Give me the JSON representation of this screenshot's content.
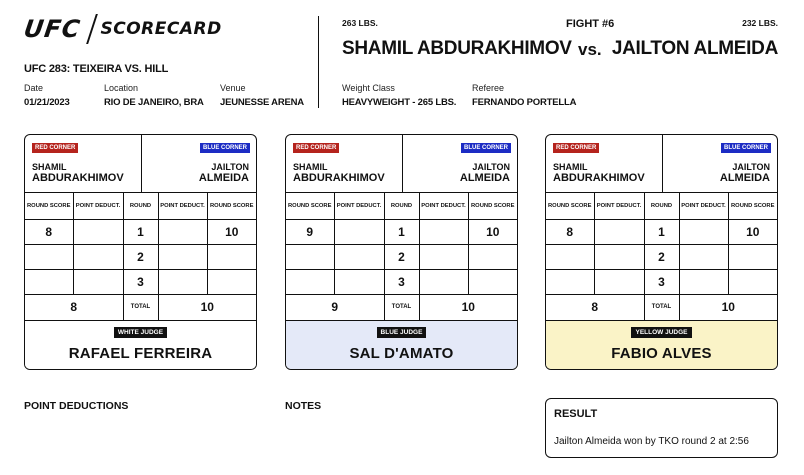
{
  "header": {
    "logo_brand": "UFC",
    "logo_product": "SCORECARD",
    "event_title": "UFC 283: TEIXEIRA VS. HILL",
    "date_label": "Date",
    "date_value": "01/21/2023",
    "location_label": "Location",
    "location_value": "RIO DE JANEIRO, BRA",
    "venue_label": "Venue",
    "venue_value": "JEUNESSE ARENA"
  },
  "fight": {
    "number": "FIGHT #6",
    "vs": "vs.",
    "red_weight": "263 LBS.",
    "red_name": "SHAMIL ABDURAKHIMOV",
    "blue_weight": "232 LBS.",
    "blue_name": "JAILTON ALMEIDA",
    "weight_class_label": "Weight Class",
    "weight_class_value": "HEAVYWEIGHT - 265 LBS.",
    "referee_label": "Referee",
    "referee_value": "FERNANDO PORTELLA"
  },
  "labels": {
    "red_corner": "RED CORNER",
    "blue_corner": "BLUE CORNER",
    "red_first": "SHAMIL",
    "red_last": "ABDURAKHIMOV",
    "blue_first": "JAILTON",
    "blue_last": "ALMEIDA",
    "round_score": "ROUND SCORE",
    "point_deduct": "POINT DEDUCT.",
    "round": "ROUND",
    "total": "TOTAL"
  },
  "cards": [
    {
      "judge_label": "WHITE JUDGE",
      "judge_name": "RAFAEL FERREIRA",
      "judge_color": "#ffffff",
      "rounds": [
        {
          "round": "1",
          "red_score": "8",
          "red_deduct": "",
          "blue_deduct": "",
          "blue_score": "10"
        },
        {
          "round": "2",
          "red_score": "",
          "red_deduct": "",
          "blue_deduct": "",
          "blue_score": ""
        },
        {
          "round": "3",
          "red_score": "",
          "red_deduct": "",
          "blue_deduct": "",
          "blue_score": ""
        }
      ],
      "red_total": "8",
      "blue_total": "10"
    },
    {
      "judge_label": "BLUE JUDGE",
      "judge_name": "SAL D'AMATO",
      "judge_color": "#e4e9f8",
      "rounds": [
        {
          "round": "1",
          "red_score": "9",
          "red_deduct": "",
          "blue_deduct": "",
          "blue_score": "10"
        },
        {
          "round": "2",
          "red_score": "",
          "red_deduct": "",
          "blue_deduct": "",
          "blue_score": ""
        },
        {
          "round": "3",
          "red_score": "",
          "red_deduct": "",
          "blue_deduct": "",
          "blue_score": ""
        }
      ],
      "red_total": "9",
      "blue_total": "10"
    },
    {
      "judge_label": "YELLOW JUDGE",
      "judge_name": "FABIO ALVES",
      "judge_color": "#faf3c7",
      "rounds": [
        {
          "round": "1",
          "red_score": "8",
          "red_deduct": "",
          "blue_deduct": "",
          "blue_score": "10"
        },
        {
          "round": "2",
          "red_score": "",
          "red_deduct": "",
          "blue_deduct": "",
          "blue_score": ""
        },
        {
          "round": "3",
          "red_score": "",
          "red_deduct": "",
          "blue_deduct": "",
          "blue_score": ""
        }
      ],
      "red_total": "8",
      "blue_total": "10"
    }
  ],
  "footer": {
    "point_deductions_title": "POINT DEDUCTIONS",
    "notes_title": "NOTES",
    "result_title": "RESULT",
    "result_text": "Jailton Almeida won by TKO round 2 at 2:56"
  },
  "colors": {
    "red_corner": "#b5231d",
    "blue_corner": "#1c2cc4"
  }
}
